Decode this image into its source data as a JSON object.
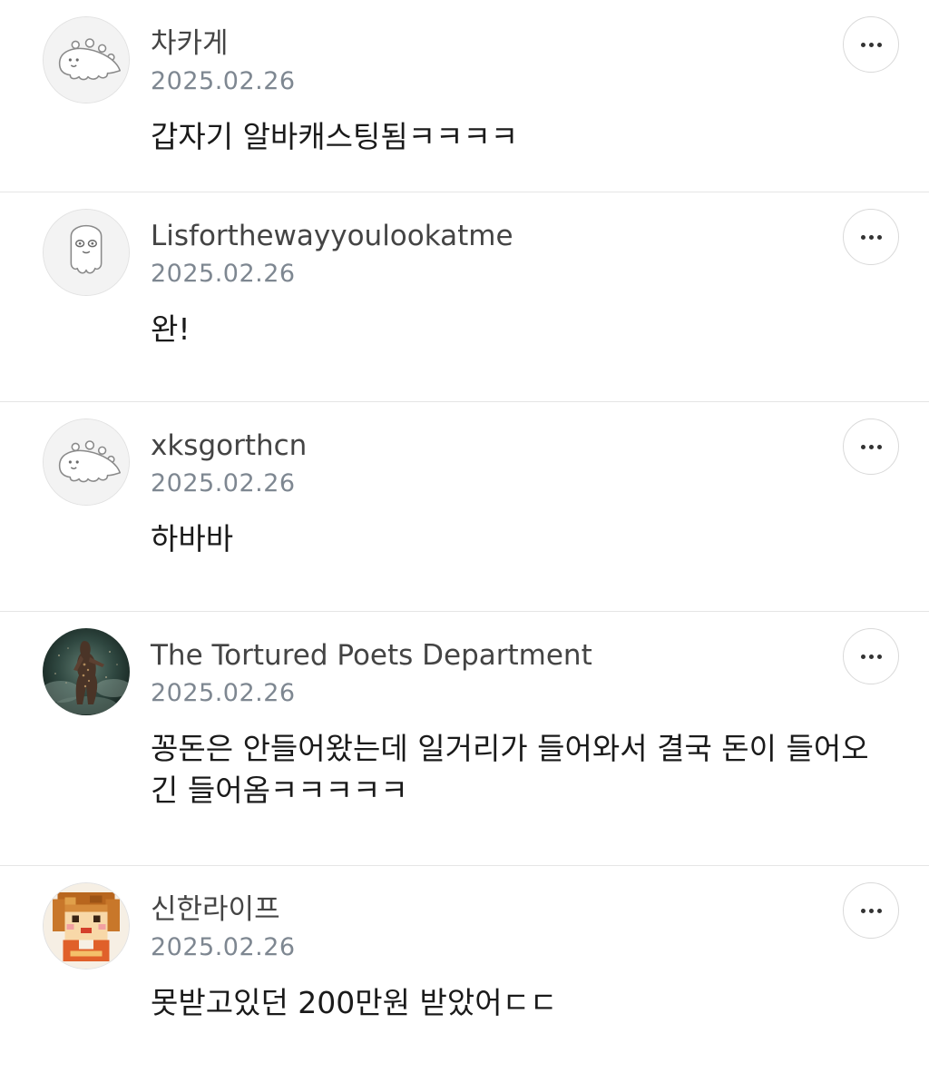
{
  "comments": [
    {
      "avatar": "dino-placeholder",
      "username": "차카게",
      "date": "2025.02.26",
      "text": "갑자기 알바캐스팅됨ㅋㅋㅋㅋ"
    },
    {
      "avatar": "ghost-placeholder",
      "username": "Lisforthewayyoulookatme",
      "date": "2025.02.26",
      "text": "완!"
    },
    {
      "avatar": "dino-placeholder",
      "username": "xksgorthcn",
      "date": "2025.02.26",
      "text": "하바바"
    },
    {
      "avatar": "photo-performer",
      "username": "The Tortured Poets Department",
      "date": "2025.02.26",
      "text": "꽁돈은 안들어왔는데 일거리가 들어와서 결국 돈이 들어오긴 들어옴ㅋㅋㅋㅋㅋ"
    },
    {
      "avatar": "pixel-character",
      "username": "신한라이프",
      "date": "2025.02.26",
      "text": "못받고있던 200만원 받았어ㄷㄷ"
    }
  ],
  "colors": {
    "username": "#444444",
    "date": "#7e8791",
    "divider": "#e5e5e5"
  },
  "icons": {
    "more": "more-horizontal-icon"
  }
}
